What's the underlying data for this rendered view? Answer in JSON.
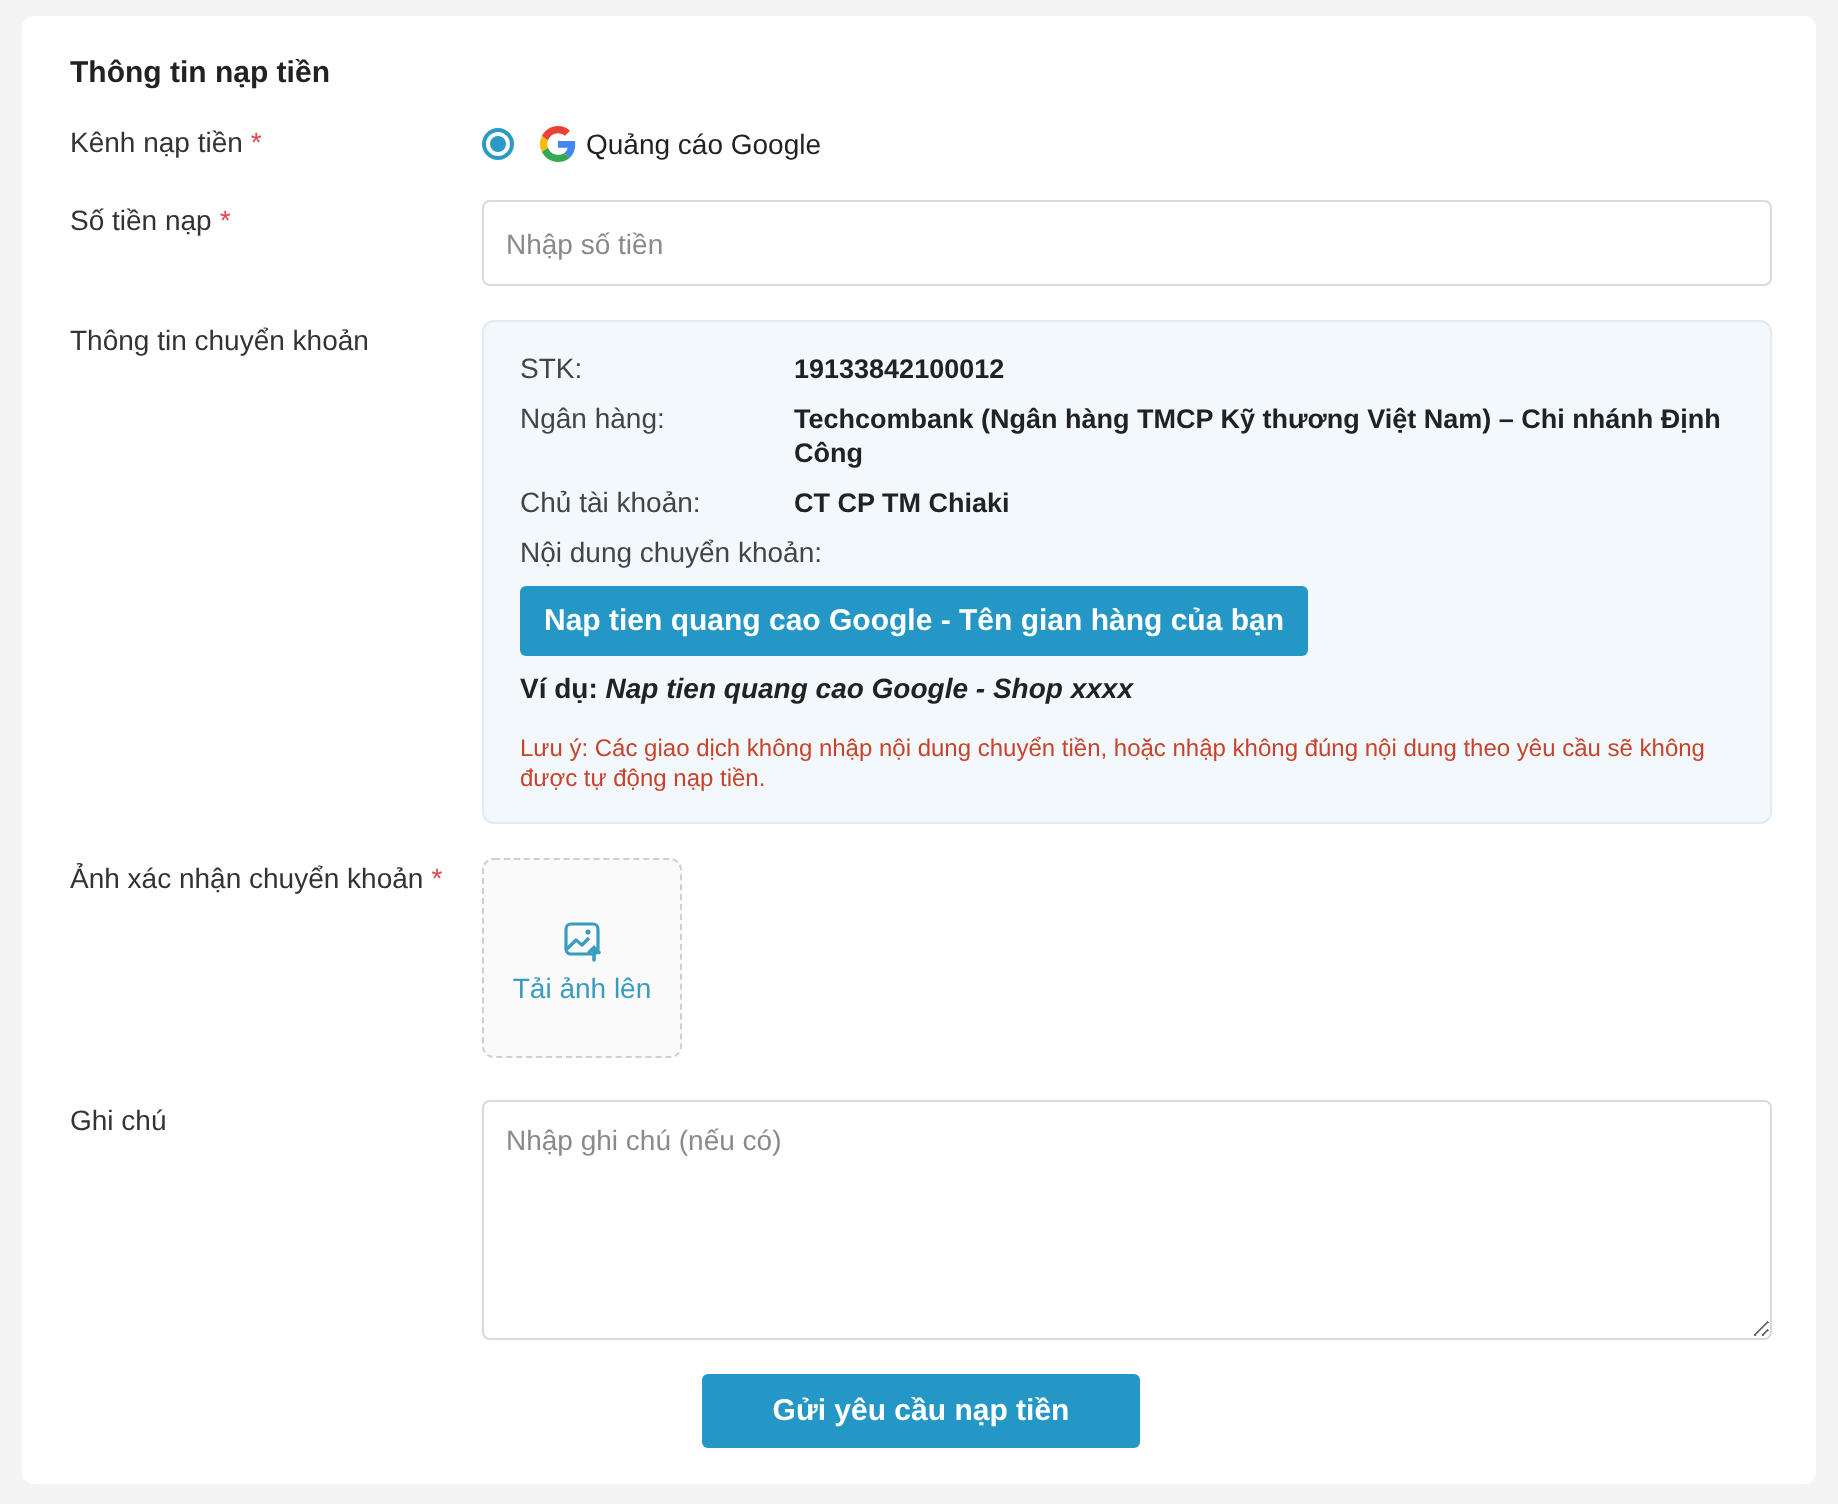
{
  "form": {
    "title": "Thông tin nạp tiền",
    "fields": [
      {
        "kind": "radio",
        "label": "Kênh nạp tiền",
        "required_mark": "*",
        "options": [
          {
            "label": "Quảng cáo Google",
            "selected": true
          }
        ]
      },
      {
        "kind": "input",
        "label": "Số tiền nạp",
        "required_mark": "*",
        "placeholder": "Nhập số tiền"
      },
      {
        "kind": "transfer_info",
        "label": "Thông tin chuyển khoản",
        "details": [
          {
            "label": "STK:",
            "value": "19133842100012"
          },
          {
            "label": "Ngân hàng:",
            "value": "Techcombank (Ngân hàng TMCP Kỹ thương Việt Nam) – Chi nhánh Định Công"
          },
          {
            "label": "Chủ tài khoản:",
            "value": "CT CP TM Chiaki"
          }
        ],
        "content_label": "Nội dung chuyển khoản:",
        "content": "Nap tien quang cao Google - Tên gian hàng của bạn",
        "example": "Ví dụ: *Nap tien quang cao Google - Shop xxxx*",
        "note": "Lưu ý: Các giao dịch không nhập nội dung chuyển tiền, hoặc nhập không đúng nội dung theo yêu cầu sẽ không được tự động nạp tiền."
      },
      {
        "kind": "upload",
        "label": "Ảnh xác nhận chuyển khoản",
        "required_mark": "*",
        "button": "Tải ảnh lên"
      },
      {
        "kind": "textarea",
        "label": "Ghi chú",
        "placeholder": "Nhập ghi chú (nếu có)"
      }
    ],
    "submit": "Gửi yêu cầu nạp tiền"
  }
}
